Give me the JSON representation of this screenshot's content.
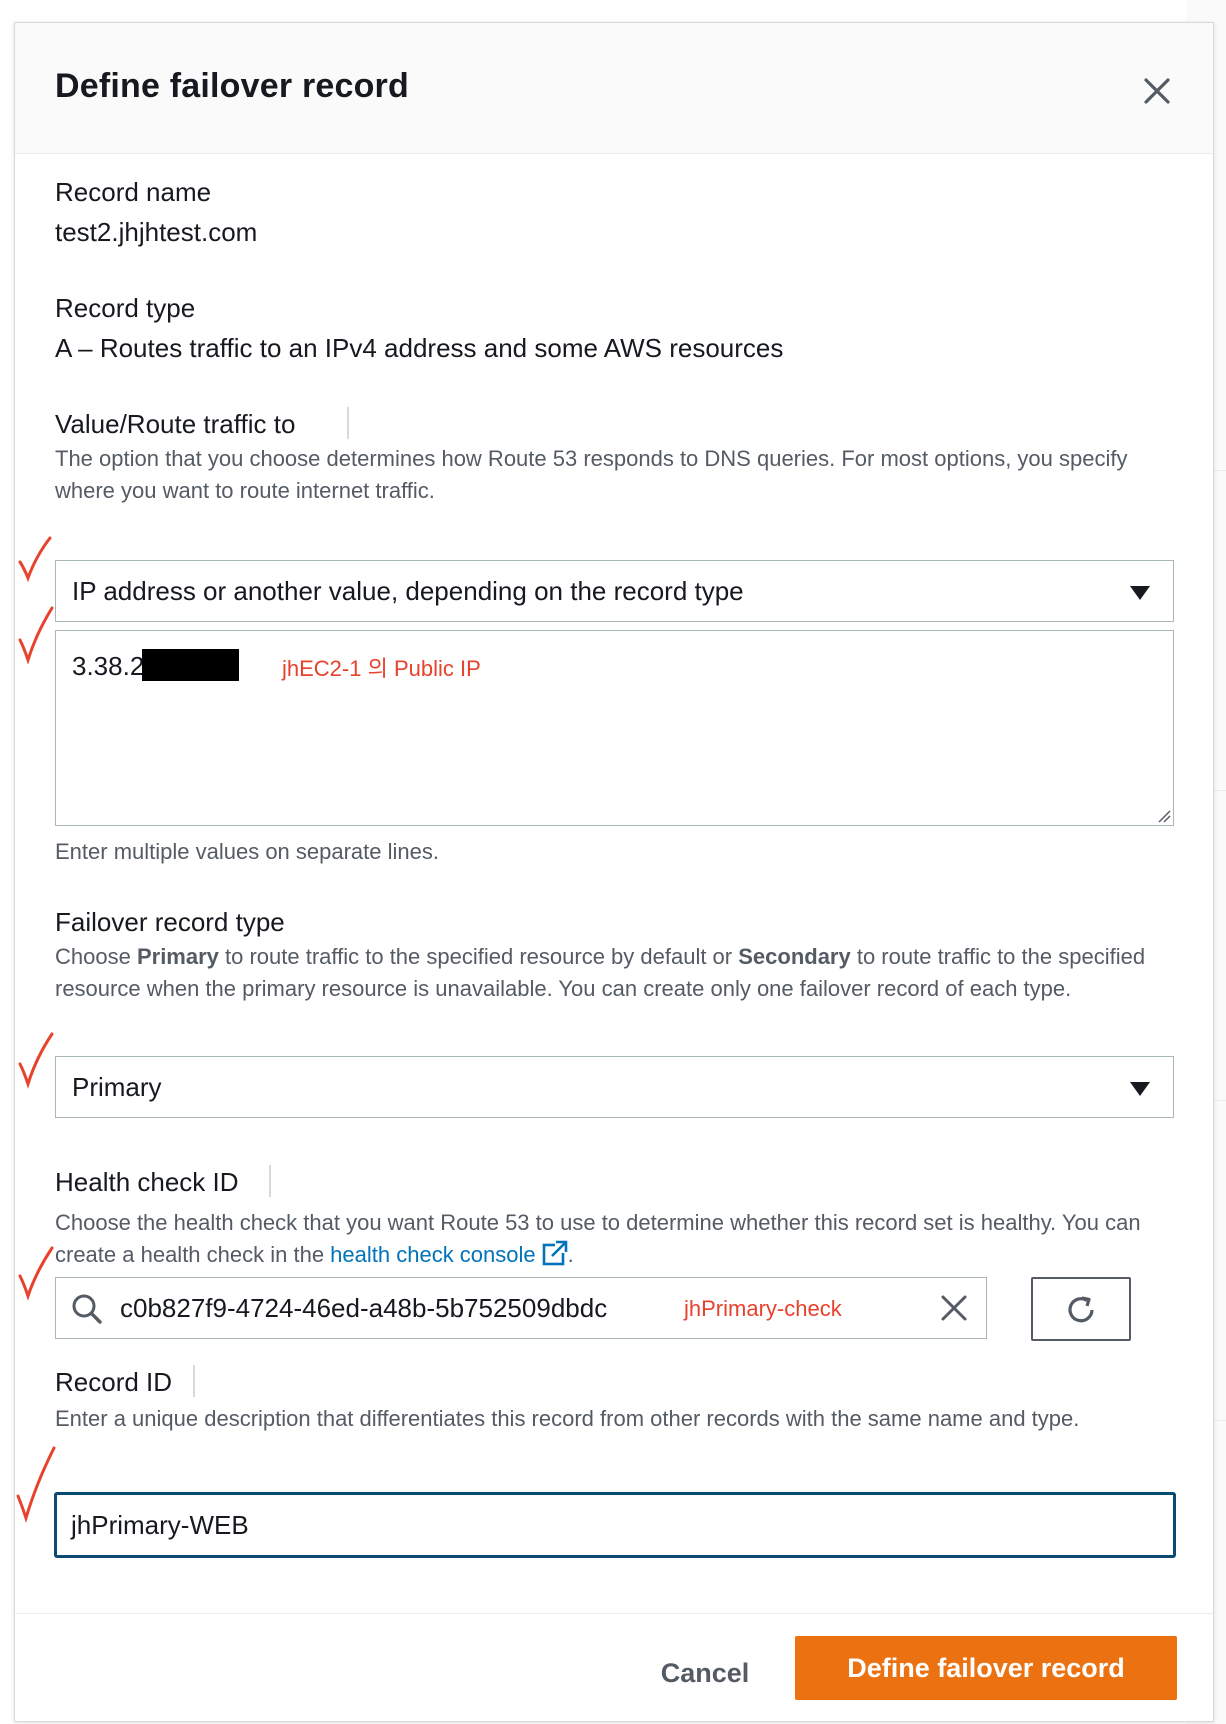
{
  "modal": {
    "title": "Define failover record"
  },
  "record_name": {
    "label": "Record name",
    "value": "test2.jhjhtest.com"
  },
  "record_type": {
    "label": "Record type",
    "value": "A – Routes traffic to an IPv4 address and some AWS resources"
  },
  "value_route": {
    "label": "Value/Route traffic to",
    "description": "The option that you choose determines how Route 53 responds to DNS queries. For most options, you specify where you want to route internet traffic.",
    "select_value": "IP address or another value, depending on the record type",
    "textarea_value": "3.38.2",
    "annotation": "jhEC2-1 의 Public IP",
    "hint": "Enter multiple values on separate lines."
  },
  "failover_type": {
    "label": "Failover record type",
    "desc_prefix": "Choose ",
    "desc_primary": "Primary",
    "desc_middle": " to route traffic to the specified resource by default or ",
    "desc_secondary": "Secondary",
    "desc_suffix": " to route traffic to the specified resource when the primary resource is unavailable. You can create only one failover record of each type.",
    "select_value": "Primary"
  },
  "health_check": {
    "label": "Health check ID",
    "desc_prefix": "Choose the health check that you want Route 53 to use to determine whether this record set is healthy. You can create a health check in the ",
    "link_text": "health check console",
    "desc_suffix": ".",
    "search_value": "c0b827f9-4724-46ed-a48b-5b752509dbdc",
    "annotation": "jhPrimary-check"
  },
  "record_id": {
    "label": "Record ID",
    "description": "Enter a unique description that differentiates this record from other records with the same name and type.",
    "value": "jhPrimary-WEB"
  },
  "footer": {
    "cancel_label": "Cancel",
    "submit_label": "Define failover record"
  },
  "colors": {
    "accent": "#ec7211",
    "link": "#0073bb",
    "annotation": "#e8412c",
    "focus_border": "#0a4a74"
  },
  "icons": {
    "close": "close-icon",
    "caret": "caret-down-icon",
    "search": "search-icon",
    "clear": "clear-icon",
    "refresh": "refresh-icon",
    "external": "external-link-icon",
    "check": "checkmark-annotation-icon"
  }
}
